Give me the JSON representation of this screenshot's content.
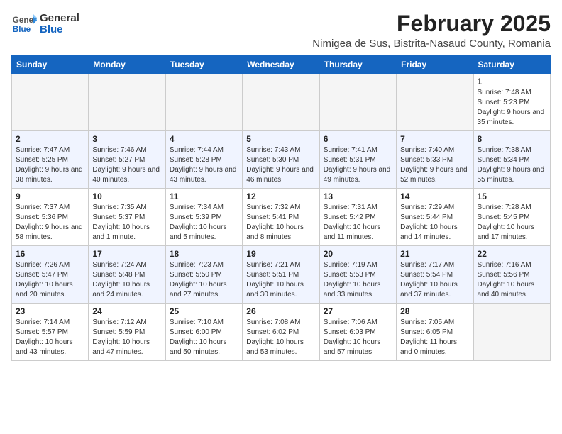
{
  "logo": {
    "text_general": "General",
    "text_blue": "Blue"
  },
  "header": {
    "month_year": "February 2025",
    "location": "Nimigea de Sus, Bistrita-Nasaud County, Romania"
  },
  "days_of_week": [
    "Sunday",
    "Monday",
    "Tuesday",
    "Wednesday",
    "Thursday",
    "Friday",
    "Saturday"
  ],
  "weeks": [
    [
      {
        "day": "",
        "info": ""
      },
      {
        "day": "",
        "info": ""
      },
      {
        "day": "",
        "info": ""
      },
      {
        "day": "",
        "info": ""
      },
      {
        "day": "",
        "info": ""
      },
      {
        "day": "",
        "info": ""
      },
      {
        "day": "1",
        "info": "Sunrise: 7:48 AM\nSunset: 5:23 PM\nDaylight: 9 hours and 35 minutes."
      }
    ],
    [
      {
        "day": "2",
        "info": "Sunrise: 7:47 AM\nSunset: 5:25 PM\nDaylight: 9 hours and 38 minutes."
      },
      {
        "day": "3",
        "info": "Sunrise: 7:46 AM\nSunset: 5:27 PM\nDaylight: 9 hours and 40 minutes."
      },
      {
        "day": "4",
        "info": "Sunrise: 7:44 AM\nSunset: 5:28 PM\nDaylight: 9 hours and 43 minutes."
      },
      {
        "day": "5",
        "info": "Sunrise: 7:43 AM\nSunset: 5:30 PM\nDaylight: 9 hours and 46 minutes."
      },
      {
        "day": "6",
        "info": "Sunrise: 7:41 AM\nSunset: 5:31 PM\nDaylight: 9 hours and 49 minutes."
      },
      {
        "day": "7",
        "info": "Sunrise: 7:40 AM\nSunset: 5:33 PM\nDaylight: 9 hours and 52 minutes."
      },
      {
        "day": "8",
        "info": "Sunrise: 7:38 AM\nSunset: 5:34 PM\nDaylight: 9 hours and 55 minutes."
      }
    ],
    [
      {
        "day": "9",
        "info": "Sunrise: 7:37 AM\nSunset: 5:36 PM\nDaylight: 9 hours and 58 minutes."
      },
      {
        "day": "10",
        "info": "Sunrise: 7:35 AM\nSunset: 5:37 PM\nDaylight: 10 hours and 1 minute."
      },
      {
        "day": "11",
        "info": "Sunrise: 7:34 AM\nSunset: 5:39 PM\nDaylight: 10 hours and 5 minutes."
      },
      {
        "day": "12",
        "info": "Sunrise: 7:32 AM\nSunset: 5:41 PM\nDaylight: 10 hours and 8 minutes."
      },
      {
        "day": "13",
        "info": "Sunrise: 7:31 AM\nSunset: 5:42 PM\nDaylight: 10 hours and 11 minutes."
      },
      {
        "day": "14",
        "info": "Sunrise: 7:29 AM\nSunset: 5:44 PM\nDaylight: 10 hours and 14 minutes."
      },
      {
        "day": "15",
        "info": "Sunrise: 7:28 AM\nSunset: 5:45 PM\nDaylight: 10 hours and 17 minutes."
      }
    ],
    [
      {
        "day": "16",
        "info": "Sunrise: 7:26 AM\nSunset: 5:47 PM\nDaylight: 10 hours and 20 minutes."
      },
      {
        "day": "17",
        "info": "Sunrise: 7:24 AM\nSunset: 5:48 PM\nDaylight: 10 hours and 24 minutes."
      },
      {
        "day": "18",
        "info": "Sunrise: 7:23 AM\nSunset: 5:50 PM\nDaylight: 10 hours and 27 minutes."
      },
      {
        "day": "19",
        "info": "Sunrise: 7:21 AM\nSunset: 5:51 PM\nDaylight: 10 hours and 30 minutes."
      },
      {
        "day": "20",
        "info": "Sunrise: 7:19 AM\nSunset: 5:53 PM\nDaylight: 10 hours and 33 minutes."
      },
      {
        "day": "21",
        "info": "Sunrise: 7:17 AM\nSunset: 5:54 PM\nDaylight: 10 hours and 37 minutes."
      },
      {
        "day": "22",
        "info": "Sunrise: 7:16 AM\nSunset: 5:56 PM\nDaylight: 10 hours and 40 minutes."
      }
    ],
    [
      {
        "day": "23",
        "info": "Sunrise: 7:14 AM\nSunset: 5:57 PM\nDaylight: 10 hours and 43 minutes."
      },
      {
        "day": "24",
        "info": "Sunrise: 7:12 AM\nSunset: 5:59 PM\nDaylight: 10 hours and 47 minutes."
      },
      {
        "day": "25",
        "info": "Sunrise: 7:10 AM\nSunset: 6:00 PM\nDaylight: 10 hours and 50 minutes."
      },
      {
        "day": "26",
        "info": "Sunrise: 7:08 AM\nSunset: 6:02 PM\nDaylight: 10 hours and 53 minutes."
      },
      {
        "day": "27",
        "info": "Sunrise: 7:06 AM\nSunset: 6:03 PM\nDaylight: 10 hours and 57 minutes."
      },
      {
        "day": "28",
        "info": "Sunrise: 7:05 AM\nSunset: 6:05 PM\nDaylight: 11 hours and 0 minutes."
      },
      {
        "day": "",
        "info": ""
      }
    ]
  ]
}
